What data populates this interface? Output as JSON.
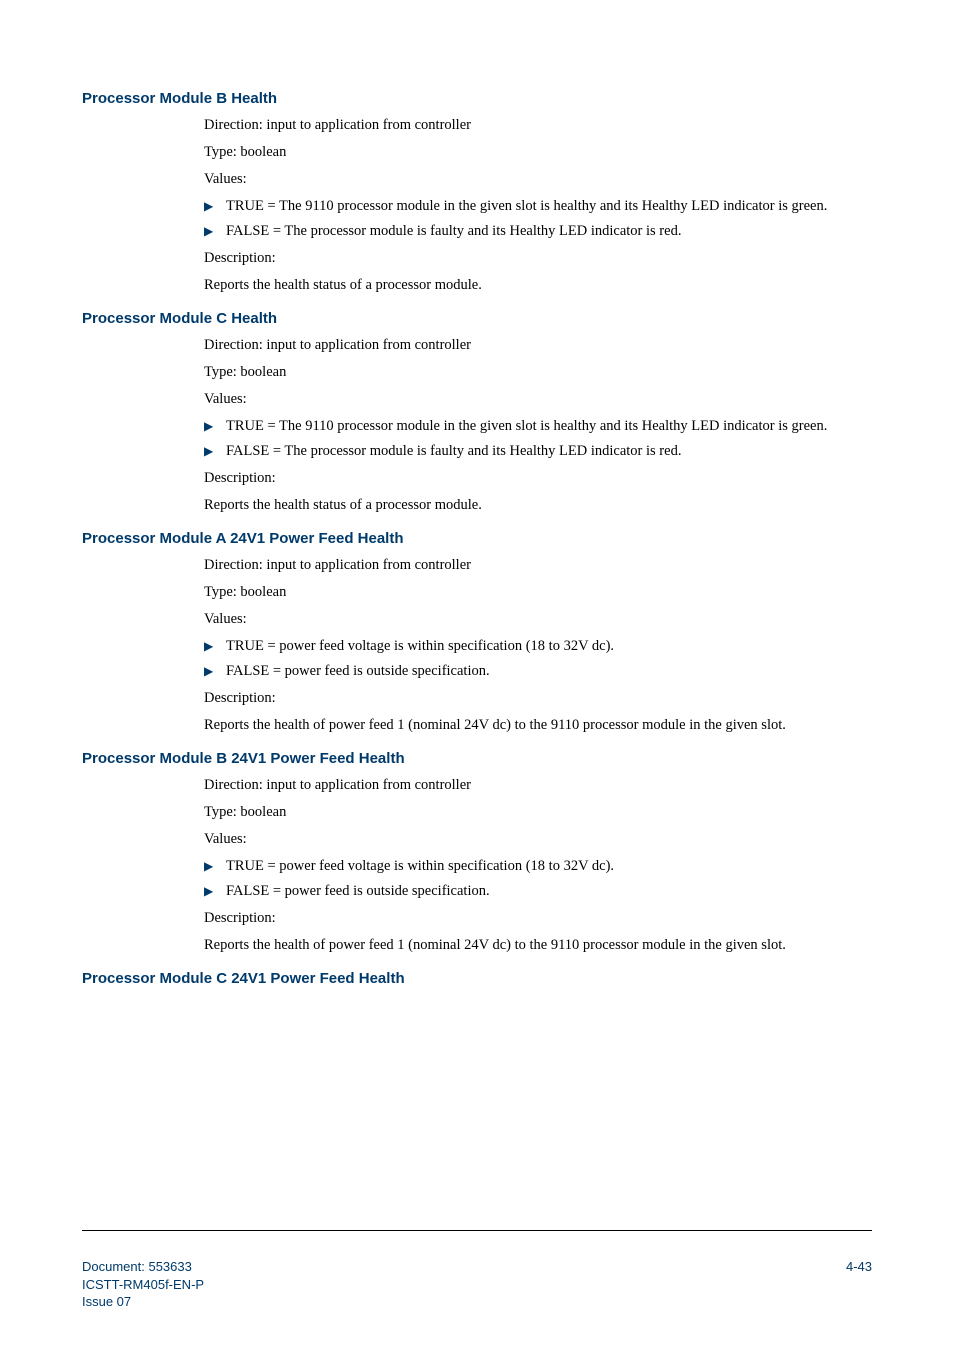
{
  "sections": {
    "b_health": {
      "heading": "Processor Module B Health",
      "direction": "Direction: input to application from controller",
      "type": "Type: boolean",
      "values_label": "Values:",
      "bullets": {
        "b0": "TRUE = The 9110 processor module in the given slot is healthy and its Healthy LED indicator is green.",
        "b1": "FALSE = The processor module is faulty and its Healthy LED indicator is red."
      },
      "description_label": "Description:",
      "description_text": "Reports the health status of a processor module."
    },
    "c_health": {
      "heading": "Processor Module C Health",
      "direction": "Direction: input to application from controller",
      "type": "Type: boolean",
      "values_label": "Values:",
      "bullets": {
        "b0": "TRUE = The 9110 processor module in the given slot is healthy and its Healthy LED indicator is green.",
        "b1": "FALSE = The processor module is faulty and its Healthy LED indicator is red."
      },
      "description_label": "Description:",
      "description_text": "Reports the health status of a processor module."
    },
    "a_24v1": {
      "heading": "Processor Module A 24V1 Power Feed Health",
      "direction": "Direction: input to application from controller",
      "type": "Type: boolean",
      "values_label": "Values:",
      "bullets": {
        "b0": "TRUE = power feed voltage is within specification (18 to 32V dc).",
        "b1": "FALSE = power feed is outside specification."
      },
      "description_label": "Description:",
      "description_text": "Reports the health of power feed 1 (nominal 24V dc) to the 9110 processor module in the given slot."
    },
    "b_24v1": {
      "heading": "Processor Module B 24V1 Power Feed Health",
      "direction": "Direction: input to application from controller",
      "type": "Type: boolean",
      "values_label": "Values:",
      "bullets": {
        "b0": "TRUE = power feed voltage is within specification (18 to 32V dc).",
        "b1": "FALSE = power feed is outside specification."
      },
      "description_label": "Description:",
      "description_text": "Reports the health of power feed 1 (nominal 24V dc) to the 9110 processor module in the given slot."
    },
    "c_24v1": {
      "heading": "Processor Module C 24V1 Power Feed Health"
    }
  },
  "footer": {
    "doc": "Document: 553633",
    "ref": "ICSTT-RM405f-EN-P",
    "issue": "Issue 07",
    "page": "4-43"
  }
}
